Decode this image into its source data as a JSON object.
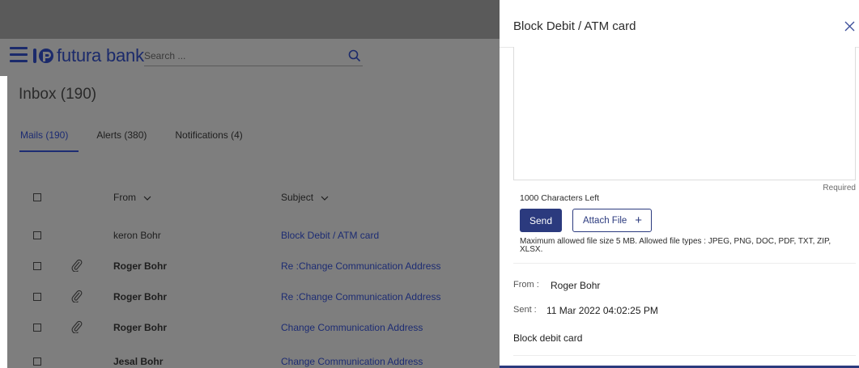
{
  "header": {
    "brand": "futura bank",
    "search_placeholder": "Search ..."
  },
  "inbox": {
    "title": "Inbox (190)",
    "tabs": [
      {
        "label": "Mails (190)",
        "active": true
      },
      {
        "label": "Alerts (380)",
        "active": false
      },
      {
        "label": "Notifications (4)",
        "active": false
      }
    ],
    "columns": {
      "from": "From",
      "subject": "Subject"
    },
    "rows": [
      {
        "from": "keron Bohr",
        "subject": "Block Debit / ATM card",
        "attachment": false,
        "unread": false
      },
      {
        "from": "Roger Bohr",
        "subject": "Re :Change Communication Address",
        "attachment": true,
        "unread": true
      },
      {
        "from": "Roger Bohr",
        "subject": "Re :Change Communication Address",
        "attachment": true,
        "unread": true
      },
      {
        "from": "Roger Bohr",
        "subject": "Change Communication Address",
        "attachment": true,
        "unread": true
      },
      {
        "from": "Jesal Bohr",
        "subject": "Change Communication Address",
        "attachment": false,
        "unread": true
      }
    ]
  },
  "panel": {
    "title": "Block Debit / ATM card",
    "required_label": "Required",
    "chars_left": "1000 Characters Left",
    "send_label": "Send",
    "attach_label": "Attach File",
    "file_info": "Maximum allowed file size 5 MB. Allowed file types : JPEG, PNG, DOC, PDF, TXT, ZIP, XLSX.",
    "from_label": "From :",
    "from_value": "Roger Bohr",
    "sent_label": "Sent :",
    "sent_value": "11 Mar 2022 04:02:25 PM",
    "body": "Block debit card"
  },
  "colors": {
    "brand": "#1b2a6b",
    "primary_button": "#2b3a7e",
    "link": "#1d2c73"
  }
}
